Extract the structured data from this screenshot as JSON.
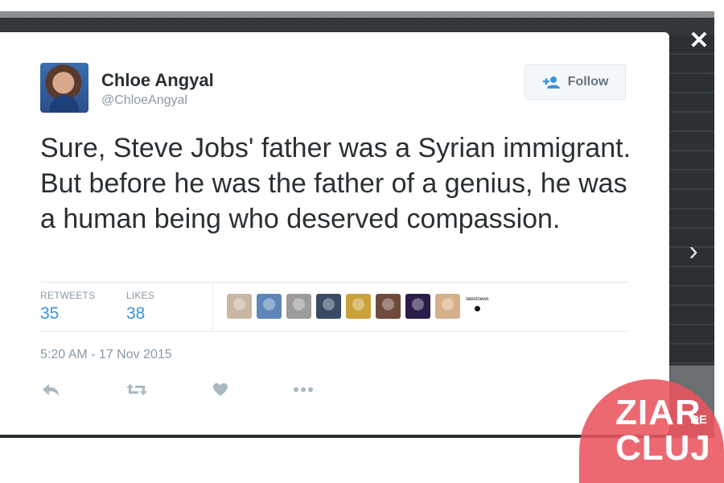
{
  "tweet": {
    "author": {
      "name": "Chloe Angyal",
      "handle": "@ChloeAngyal"
    },
    "follow_label": "Follow",
    "text": "Sure, Steve Jobs' father was a Syrian immigrant. But before he was the father of a genius, he was a human being who deserved compassion.",
    "stats": {
      "retweets_label": "RETWEETS",
      "retweets_value": "35",
      "likes_label": "LIKES",
      "likes_value": "38"
    },
    "likers": [
      {
        "icon": "avatar-photo",
        "color": "#c9b7a3"
      },
      {
        "icon": "avatar-photo",
        "color": "#5e86b8"
      },
      {
        "icon": "avatar-photo",
        "color": "#9c9c9c"
      },
      {
        "icon": "avatar-photo",
        "color": "#3b4a63"
      },
      {
        "icon": "avatar-photo",
        "color": "#c9a23a"
      },
      {
        "icon": "avatar-photo",
        "color": "#6f4a3a"
      },
      {
        "icon": "avatar-photo",
        "color": "#2b1d4a"
      },
      {
        "icon": "avatar-photo",
        "color": "#d6b08a"
      },
      {
        "icon": "latestnews-logo",
        "label": "latestnews"
      }
    ],
    "timestamp": "5:20 AM - 17 Nov 2015",
    "actions": [
      "reply-icon",
      "retweet-icon",
      "like-icon",
      "more-icon"
    ]
  },
  "overlay": {
    "close_icon": "close-icon",
    "next_icon": "chevron-right-icon"
  },
  "watermark": {
    "line1": "ZIAR",
    "line2": "DE",
    "line3": "CLUJ",
    "color": "#ea545f"
  }
}
